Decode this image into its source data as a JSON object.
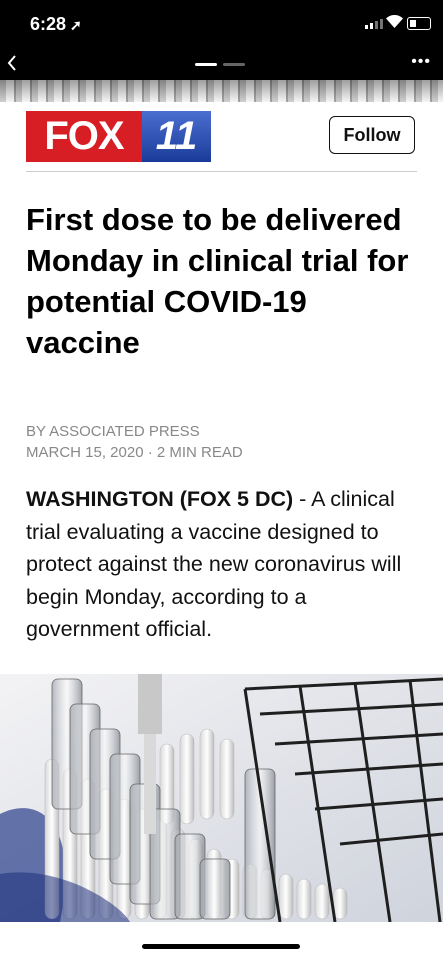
{
  "status": {
    "time": "6:28"
  },
  "topbar": {
    "back_icon": "chevron-left-icon",
    "more_icon": "more-dots-icon"
  },
  "publisher": {
    "logo_left": "FOX",
    "logo_right": "11",
    "follow_label": "Follow"
  },
  "article": {
    "headline": "First dose to be delivered Monday in clinical trial for potential COVID-19 vaccine",
    "byline": "BY ASSOCIATED PRESS",
    "meta": "MARCH 15, 2020 · 2 MIN READ",
    "dateline": "WASHINGTON (FOX 5 DC)",
    "lede": " - A clinical trial evaluating a vaccine designed to protect against the new coronavirus will begin Monday, according to a government official."
  }
}
